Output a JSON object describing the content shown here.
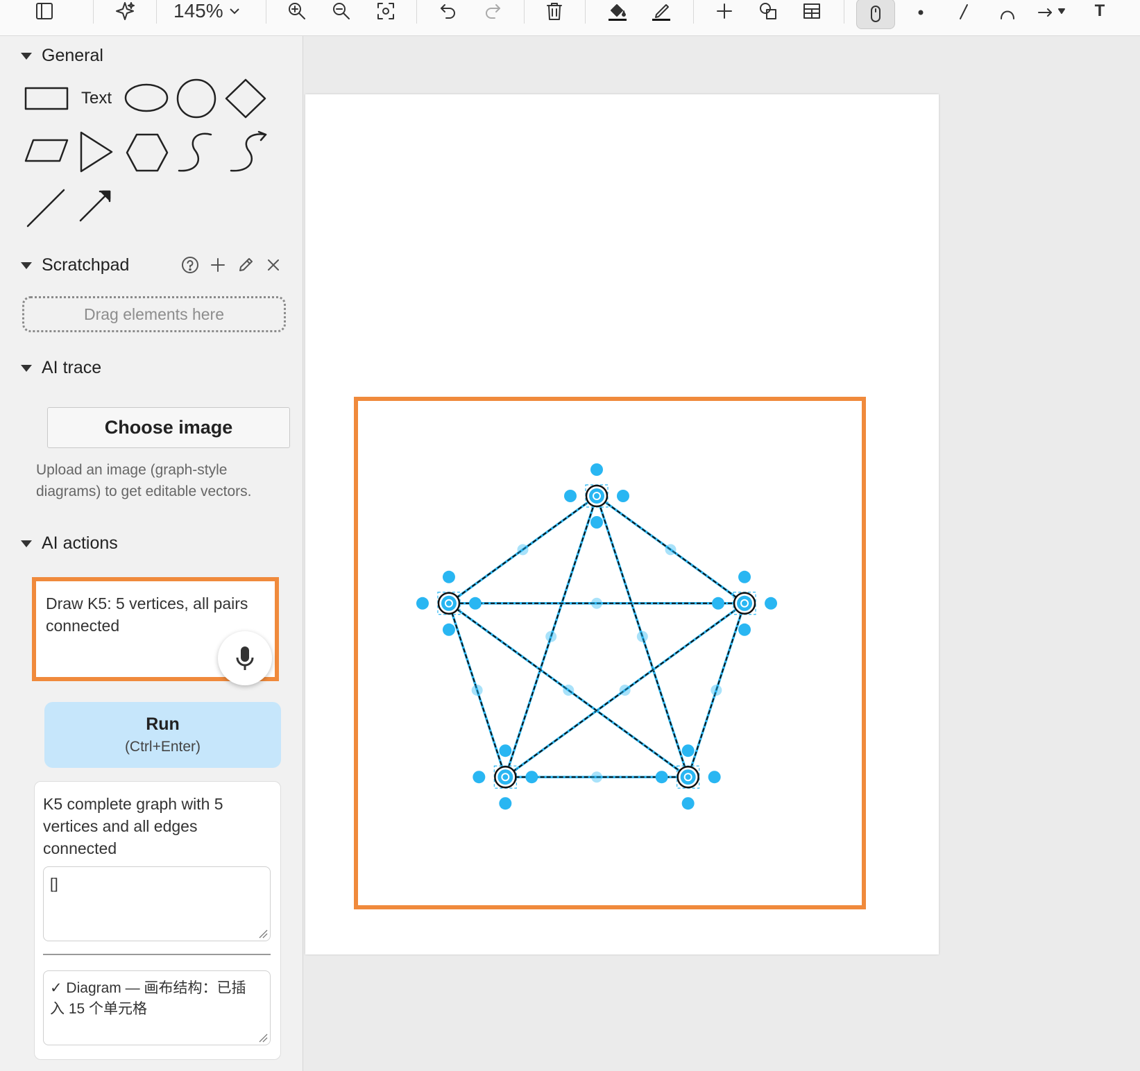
{
  "toolbar": {
    "zoom_level": "145%",
    "icons": [
      "sidebar-toggle-icon",
      "magic-sparkle-icon",
      "zoom-in-icon",
      "zoom-out-icon",
      "fit-screen-icon",
      "undo-icon",
      "redo-icon",
      "delete-icon",
      "fill-color-icon",
      "line-color-icon",
      "insert-icon",
      "shapes-icon",
      "table-icon",
      "mouse-pointer-icon",
      "point-tool-icon",
      "line-tool-icon",
      "curve-tool-icon",
      "arrow-tool-icon",
      "text-tool-icon"
    ],
    "text_tool_label": "T"
  },
  "sidebar": {
    "general": {
      "title": "General",
      "text_shape_label": "Text",
      "shapes": [
        "rectangle",
        "text",
        "ellipse",
        "circle",
        "diamond",
        "parallelogram",
        "triangle",
        "hexagon",
        "curve",
        "curved-arrow",
        "line",
        "arrow"
      ]
    },
    "scratchpad": {
      "title": "Scratchpad",
      "drop_placeholder": "Drag elements here",
      "icons": [
        "help-icon",
        "add-icon",
        "edit-icon",
        "close-icon"
      ]
    },
    "ai_trace": {
      "title": "AI trace",
      "choose_button": "Choose image",
      "help_text": "Upload an image (graph-style diagrams) to get editable vectors."
    },
    "ai_actions": {
      "title": "AI actions",
      "prompt_text": "Draw K5: 5 vertices, all pairs connected",
      "run_label": "Run",
      "run_shortcut": "(Ctrl+Enter)",
      "result_summary": "K5 complete graph with 5 vertices and all edges connected",
      "result_json": "[]",
      "result_log": "✓ Diagram — 画布结构：已插入 15 个单元格"
    }
  },
  "colors": {
    "accent_orange": "#f08a3c",
    "handle_blue": "#29b6f2",
    "run_button_bg": "#c6e6fb",
    "edge_color": "#111111"
  },
  "diagram": {
    "graph_type": "complete graph",
    "vertex_count": 5,
    "edge_count": 10,
    "cell_count": 15
  }
}
